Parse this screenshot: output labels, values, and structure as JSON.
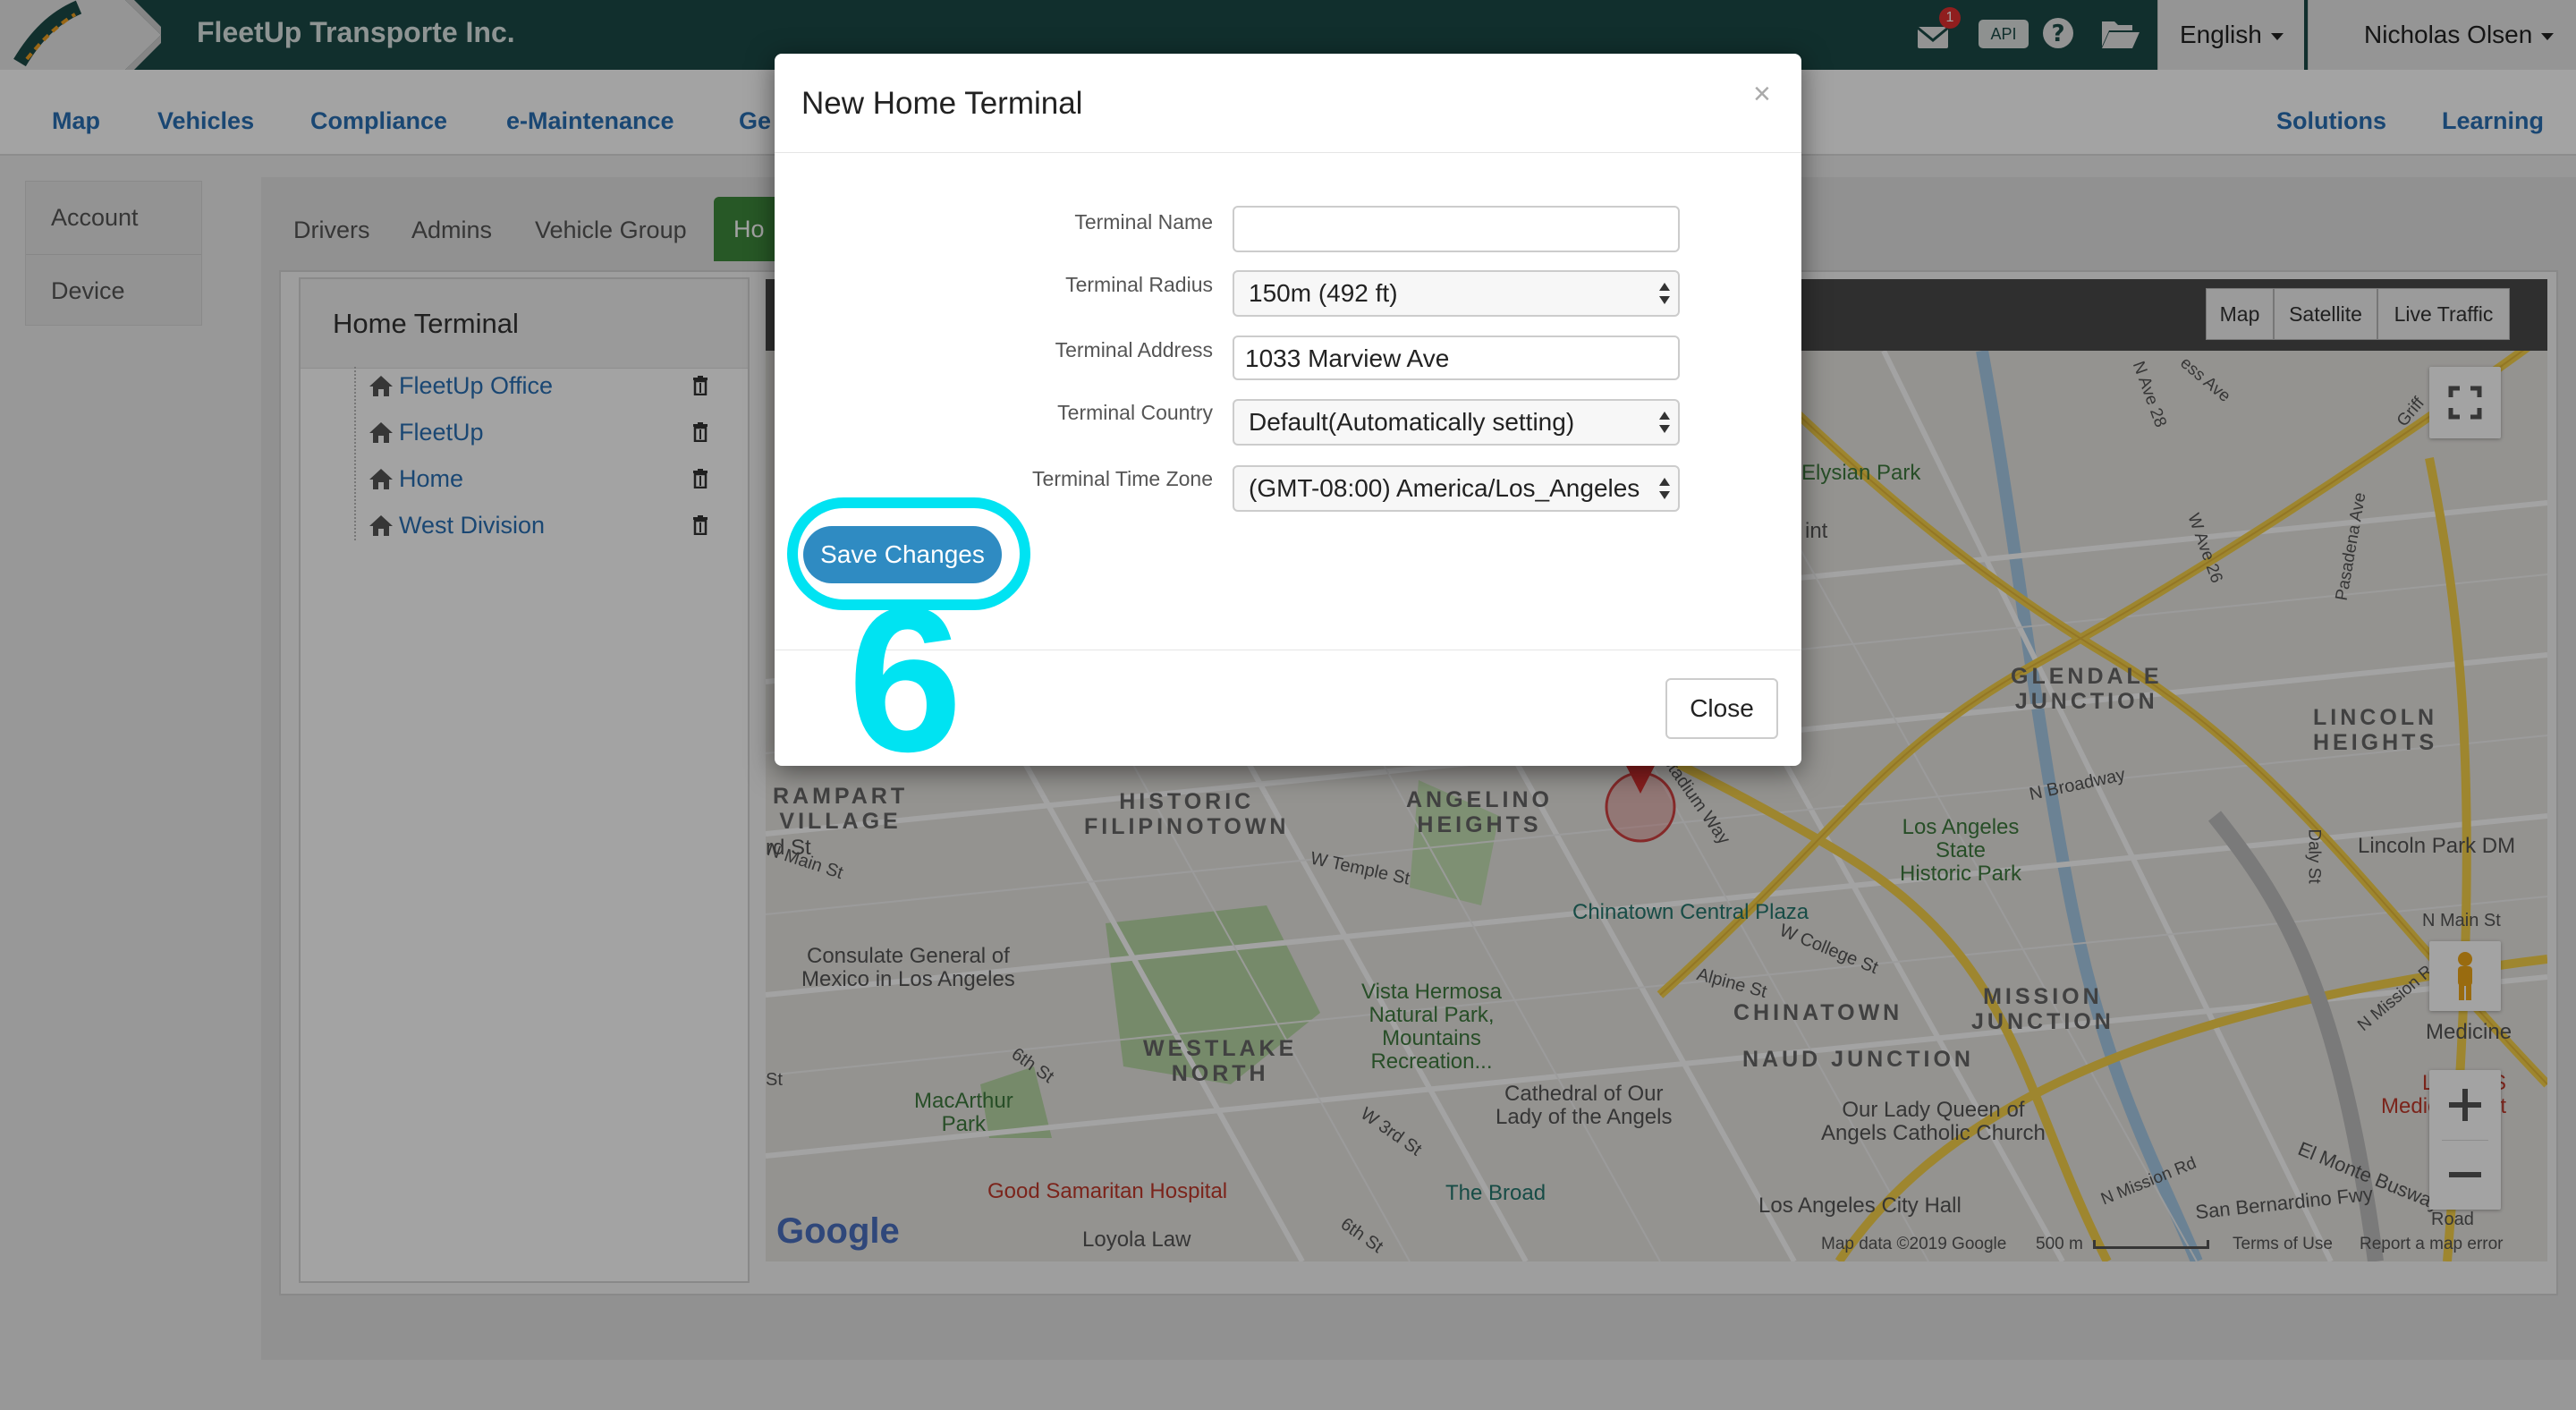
{
  "header": {
    "company": "FleetUp Transporte Inc.",
    "mail_badge": "1",
    "api_label": "API",
    "language": "English",
    "user": "Nicholas Olsen"
  },
  "nav": {
    "items": [
      "Map",
      "Vehicles",
      "Compliance",
      "e-Maintenance",
      "Ge"
    ],
    "right_items": [
      "Solutions",
      "Learning"
    ]
  },
  "left_menu": [
    "Account",
    "Device"
  ],
  "subtabs": [
    "Drivers",
    "Admins",
    "Vehicle Group"
  ],
  "active_subtab": "Ho",
  "home_terminal": {
    "title": "Home Terminal",
    "items": [
      "FleetUp Office",
      "FleetUp",
      "Home",
      "West Division"
    ]
  },
  "map": {
    "buttons": [
      "Map",
      "Satellite",
      "Live Traffic"
    ],
    "labels": {
      "elysian_park": "Elysian Park",
      "glendale_junction": "GLENDALE\nJUNCTION",
      "lincoln_heights": "LINCOLN\nHEIGHTS",
      "lincoln_park": "Lincoln Park DM",
      "rampart_village": "RAMPART\nVILLAGE",
      "historic_filipinotown": "HISTORIC\nFILIPINOTOWN",
      "angelino_heights": "ANGELINO\nHEIGHTS",
      "la_state_park": "Los Angeles\nState\nHistoric Park",
      "chinatown_plaza": "Chinatown Central Plaza",
      "consulate": "Consulate General of\nMexico in Los Angeles",
      "vista_hermosa": "Vista Hermosa\nNatural Park,\nMountains\nRecreation...",
      "westlake_north": "WESTLAKE\nNORTH",
      "chinatown": "CHINATOWN",
      "mission_junction": "MISSION\nJUNCTION",
      "naud_junction": "NAUD JUNCTION",
      "macarthur_park": "MacArthur\nPark",
      "cathedral": "Cathedral of Our\nLady of the Angels",
      "our_lady_queen": "Our Lady Queen of\nAngels Catholic Church",
      "good_samaritan": "Good Samaritan Hospital",
      "the_broad": "The Broad",
      "la_city_hall": "Los Angeles City Hall",
      "loyola_law": "Loyola Law",
      "medical_center": "LAC+US\nMedical Cent",
      "medicine": "Medicine",
      "w_temple_st": "W Temple St",
      "w_college_st": "W College St",
      "alpine_st": "Alpine St",
      "n_broadway": "N Broadway",
      "n_main_st": "N Main St",
      "n_main_st2": "N Main St",
      "sixth_st": "6th St",
      "w_3rd_st": "W 3rd St",
      "sixth_st2": "6th St",
      "stadium_way": "Stadium Way",
      "n_mission_rd": "N Mission Rd",
      "n_mission_rd2": "N Mission Rd",
      "el_monte": "El Monte Busway",
      "san_bernardino": "San Bernardino Fwy",
      "daly_st": "Daly St",
      "pasadena_ave": "Pasadena Ave",
      "w_ave_26": "W Ave 26",
      "n_ave_28": "N Ave 28",
      "ess_ave": "ess Ave",
      "griff": "Griff",
      "int": "int",
      "rd_st": "rd St",
      "st": "St",
      "road": "Road"
    },
    "google": "Google",
    "footer": {
      "data": "Map data ©2019 Google",
      "scale": "500 m",
      "terms": "Terms of Use",
      "report": "Report a map error"
    }
  },
  "modal": {
    "title": "New Home Terminal",
    "close_x": "×",
    "fields": {
      "name_label": "Terminal Name",
      "name_value": "",
      "radius_label": "Terminal Radius",
      "radius_value": "150m (492 ft)",
      "address_label": "Terminal Address",
      "address_value": "1033 Marview Ave",
      "country_label": "Terminal Country",
      "country_value": "Default(Automatically setting)",
      "timezone_label": "Terminal Time Zone",
      "timezone_value": "(GMT-08:00) America/Los_Angeles"
    },
    "save_label": "Save Changes",
    "close_label": "Close"
  },
  "annotation": {
    "step": "6",
    "color": "#00e3f2"
  }
}
